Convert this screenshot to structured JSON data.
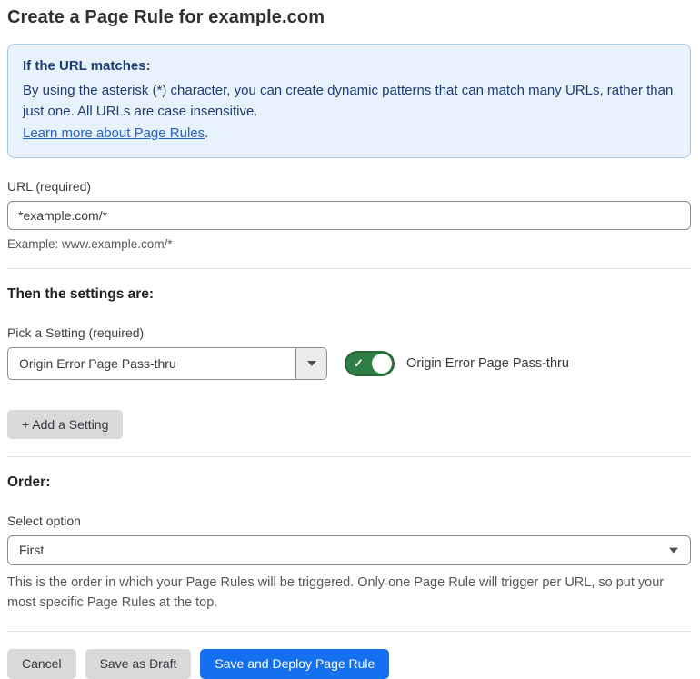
{
  "page": {
    "title": "Create a Page Rule for example.com"
  },
  "info_box": {
    "heading": "If the URL matches:",
    "body": "By using the asterisk (*) character, you can create dynamic patterns that can match many URLs, rather than just one. All URLs are case insensitive.",
    "link_label": "Learn more about Page Rules",
    "link_suffix": "."
  },
  "url_field": {
    "label": "URL (required)",
    "value": "*example.com/*",
    "helper": "Example: www.example.com/*"
  },
  "settings_section": {
    "heading": "Then the settings are:",
    "picker_label": "Pick a Setting (required)",
    "picker_value": "Origin Error Page Pass-thru",
    "toggle_state": "on",
    "toggle_label": "Origin Error Page Pass-thru",
    "add_setting_label": "+ Add a Setting"
  },
  "order_section": {
    "heading": "Order:",
    "select_label": "Select option",
    "select_value": "First",
    "helper": "This is the order in which your Page Rules will be triggered. Only one Page Rule will trigger per URL, so put your most specific Page Rules at the top."
  },
  "footer": {
    "cancel_label": "Cancel",
    "save_draft_label": "Save as Draft",
    "save_deploy_label": "Save and Deploy Page Rule"
  },
  "icons": {
    "toggle_check": "✓"
  },
  "colors": {
    "accent_blue": "#1570ef",
    "toggle_green": "#2e7d45",
    "info_bg": "#e8f2fc",
    "info_border": "#a9c7e8",
    "info_text": "#1e3c74",
    "link_blue": "#2563c9",
    "button_gray": "#d9d9d9"
  }
}
